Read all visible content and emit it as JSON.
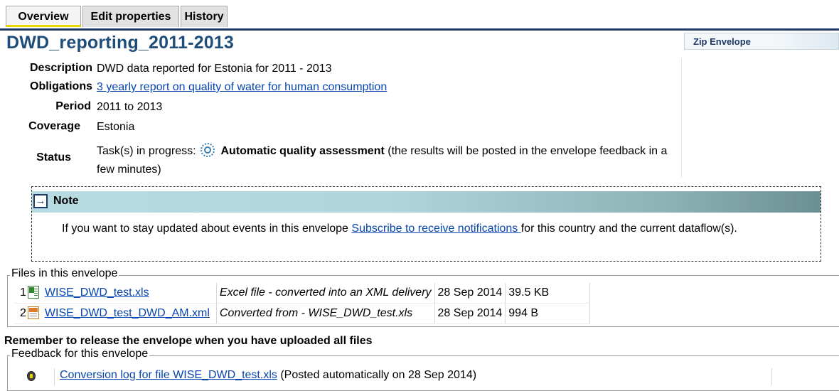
{
  "tabs": [
    {
      "label": "Overview",
      "active": true
    },
    {
      "label": "Edit properties",
      "active": false
    },
    {
      "label": "History",
      "active": false
    }
  ],
  "title": "DWD_reporting_2011-2013",
  "zip_button": "Zip Envelope",
  "properties": {
    "description": {
      "label": "Description",
      "value": "DWD data reported for Estonia for 2011 - 2013"
    },
    "obligations": {
      "label": "Obligations",
      "value": "3 yearly report on quality of water for human consumption"
    },
    "period": {
      "label": "Period",
      "value": "2011 to 2013"
    },
    "coverage": {
      "label": "Coverage",
      "value": "Estonia"
    },
    "status": {
      "label": "Status",
      "prefix": "Task(s) in progress:",
      "task": "Automatic quality assessment",
      "suffix": "(the results will be posted in the envelope feedback in a few minutes)"
    }
  },
  "note": {
    "title": "Note",
    "text_before": "If you want to stay updated about events in this envelope ",
    "link": "Subscribe to receive notifications ",
    "text_after": "for this country and the current dataflow(s)."
  },
  "files": {
    "legend": "Files in this envelope",
    "rows": [
      {
        "num": "1",
        "icon": "excel-file-icon",
        "name": "WISE_DWD_test.xls",
        "desc": "Excel file - converted into an XML delivery",
        "date": "28 Sep 2014",
        "size": "39.5 KB"
      },
      {
        "num": "2",
        "icon": "xml-file-icon",
        "name": "WISE_DWD_test_DWD_AM.xml",
        "desc": "Converted from - WISE_DWD_test.xls",
        "date": "28 Sep 2014",
        "size": "994 B"
      }
    ]
  },
  "reminder": "Remember to release the envelope when you have uploaded all files",
  "feedback": {
    "legend": "Feedback for this envelope",
    "items": [
      {
        "link": "Conversion log for file WISE_DWD_test.xls",
        "note": "(Posted automatically on 28 Sep 2014)"
      }
    ]
  },
  "colors": {
    "tab_line": "#1f3a67",
    "title": "#1f4d7a",
    "link": "#0645ad",
    "note_band": "#b0d6dc"
  }
}
